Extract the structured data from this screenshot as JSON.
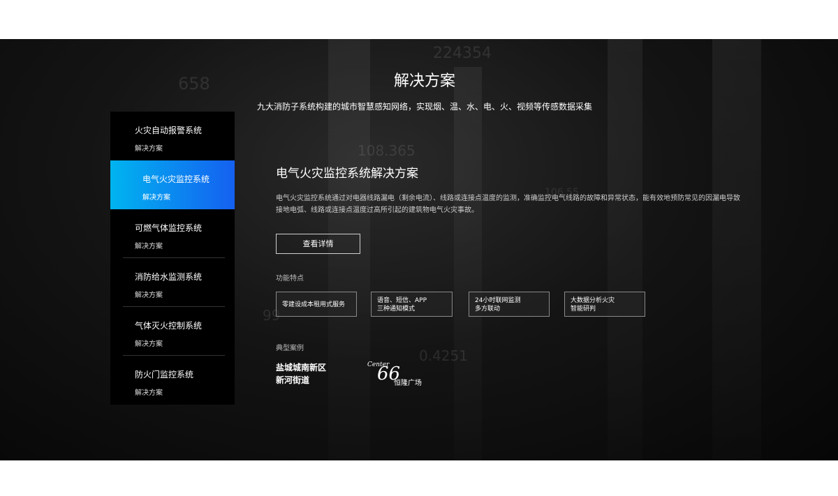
{
  "section": {
    "title": "解决方案",
    "subtitle": "九大消防子系统构建的城市智慧感知网络，实现烟、温、水、电、火、视频等传感数据采集"
  },
  "background_numbers": [
    "224354",
    "658",
    "108.365",
    "106.55",
    "99",
    "0.4251"
  ],
  "sidebar": {
    "items": [
      {
        "title": "火灾自动报警系统",
        "subtitle": "解决方案",
        "active": false
      },
      {
        "title": "电气火灾监控系统",
        "subtitle": "解决方案",
        "active": true
      },
      {
        "title": "可燃气体监控系统",
        "subtitle": "解决方案",
        "active": false
      },
      {
        "title": "消防给水监测系统",
        "subtitle": "解决方案",
        "active": false
      },
      {
        "title": "气体灭火控制系统",
        "subtitle": "解决方案",
        "active": false
      },
      {
        "title": "防火门监控系统",
        "subtitle": "解决方案",
        "active": false
      }
    ]
  },
  "detail": {
    "title": "电气火灾监控系统解决方案",
    "description": "电气火灾监控系统通过对电器线路漏电（剩余电流）、线路或连接点温度的监测，准确监控电气线路的故障和异常状态，能有效地预防常见的因漏电导致接地电弧、线路或连接点温度过高所引起的建筑物电气火灾事故。",
    "button_label": "查看详情",
    "features_label": "功能特点",
    "features": [
      {
        "line1": "零建设成本租用式服务",
        "line2": ""
      },
      {
        "line1": "语音、短信、APP",
        "line2": "三种通知模式"
      },
      {
        "line1": "24小时联网监测",
        "line2": "多方联动"
      },
      {
        "line1": "大数据分析火灾",
        "line2": "智能研判"
      }
    ],
    "cases_label": "典型案例",
    "cases": {
      "case1_line1": "盐城城南新区",
      "case1_line2": "新河街道",
      "case2_script": "Center",
      "case2_number": "66",
      "case2_name": "恒隆广场"
    }
  },
  "colors": {
    "active_gradient_start": "#00b4f0",
    "active_gradient_end": "#1560f0",
    "background": "#0a0a0a",
    "sidebar_bg": "#000000"
  }
}
